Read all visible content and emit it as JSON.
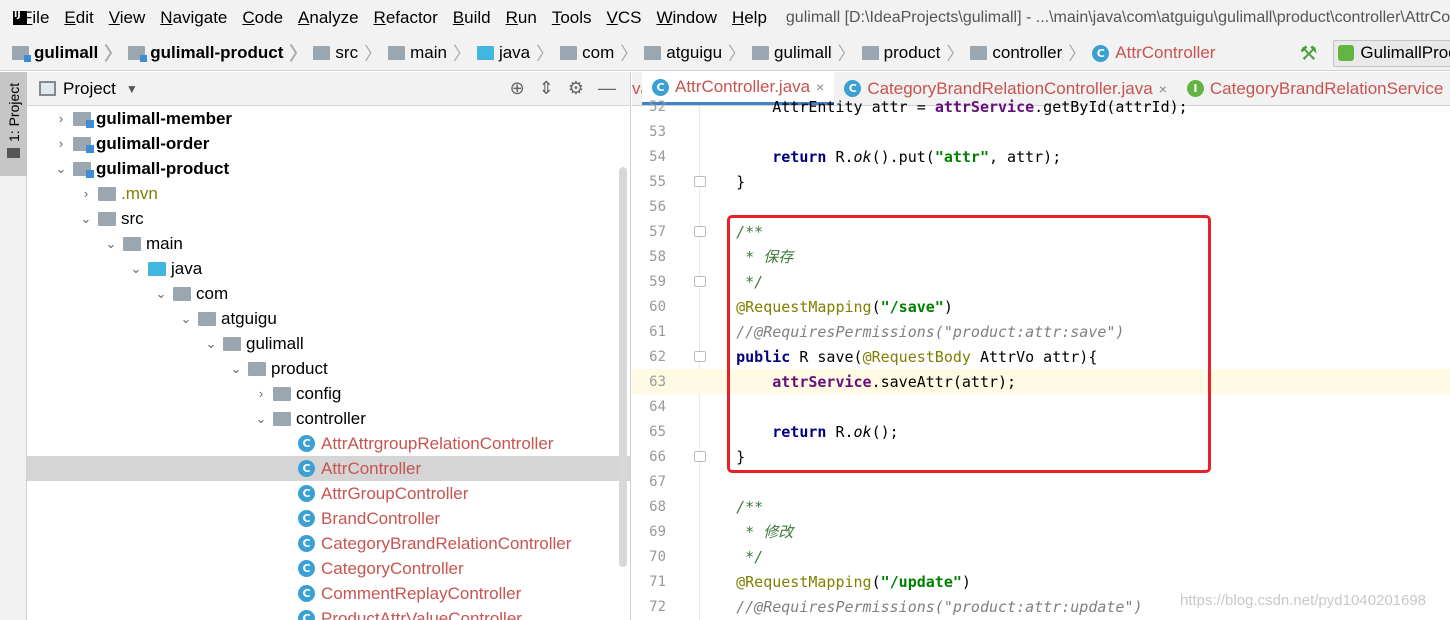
{
  "menu": {
    "items": [
      "File",
      "Edit",
      "View",
      "Navigate",
      "Code",
      "Analyze",
      "Refactor",
      "Build",
      "Run",
      "Tools",
      "VCS",
      "Window",
      "Help"
    ],
    "window_title": "gulimall [D:\\IdeaProjects\\gulimall] - ...\\main\\java\\com\\atguigu\\gulimall\\product\\controller\\AttrController.java"
  },
  "breadcrumb": {
    "items": [
      "gulimall",
      "gulimall-product",
      "src",
      "main",
      "java",
      "com",
      "atguigu",
      "gulimall",
      "product",
      "controller",
      "AttrController"
    ],
    "run_config": "GulimallProductApplication"
  },
  "toolstrip": {
    "tab_label": "1: Project"
  },
  "project_panel": {
    "title": "Project",
    "tree": [
      {
        "label": "gulimall-member",
        "depth": 0,
        "arrow": "›",
        "kind": "module"
      },
      {
        "label": "gulimall-order",
        "depth": 0,
        "arrow": "›",
        "kind": "module"
      },
      {
        "label": "gulimall-product",
        "depth": 0,
        "arrow": "⌄",
        "kind": "module"
      },
      {
        "label": ".mvn",
        "depth": 1,
        "arrow": "›",
        "kind": "folder-mvn"
      },
      {
        "label": "src",
        "depth": 1,
        "arrow": "⌄",
        "kind": "folder"
      },
      {
        "label": "main",
        "depth": 2,
        "arrow": "⌄",
        "kind": "folder"
      },
      {
        "label": "java",
        "depth": 3,
        "arrow": "⌄",
        "kind": "folder-blue"
      },
      {
        "label": "com",
        "depth": 4,
        "arrow": "⌄",
        "kind": "folder"
      },
      {
        "label": "atguigu",
        "depth": 5,
        "arrow": "⌄",
        "kind": "folder"
      },
      {
        "label": "gulimall",
        "depth": 6,
        "arrow": "⌄",
        "kind": "folder"
      },
      {
        "label": "product",
        "depth": 7,
        "arrow": "⌄",
        "kind": "folder"
      },
      {
        "label": "config",
        "depth": 8,
        "arrow": "›",
        "kind": "folder"
      },
      {
        "label": "controller",
        "depth": 8,
        "arrow": "⌄",
        "kind": "folder"
      },
      {
        "label": "AttrAttrgroupRelationController",
        "depth": 9,
        "arrow": "",
        "kind": "class"
      },
      {
        "label": "AttrController",
        "depth": 9,
        "arrow": "",
        "kind": "class",
        "selected": true
      },
      {
        "label": "AttrGroupController",
        "depth": 9,
        "arrow": "",
        "kind": "class"
      },
      {
        "label": "BrandController",
        "depth": 9,
        "arrow": "",
        "kind": "class"
      },
      {
        "label": "CategoryBrandRelationController",
        "depth": 9,
        "arrow": "",
        "kind": "class"
      },
      {
        "label": "CategoryController",
        "depth": 9,
        "arrow": "",
        "kind": "class"
      },
      {
        "label": "CommentReplayController",
        "depth": 9,
        "arrow": "",
        "kind": "class"
      },
      {
        "label": "ProductAttrValueController",
        "depth": 9,
        "arrow": "",
        "kind": "class"
      }
    ]
  },
  "editor": {
    "tabs": [
      {
        "label": "va",
        "icon": "",
        "close": false,
        "truncated": true
      },
      {
        "label": "AttrController.java",
        "icon": "C",
        "close": true,
        "active": true
      },
      {
        "label": "CategoryBrandRelationController.java",
        "icon": "C",
        "close": true
      },
      {
        "label": "CategoryBrandRelationService",
        "icon": "I",
        "close": false
      }
    ],
    "lines": [
      {
        "n": "52",
        "html": "        <span>AttrEntity attr = </span><span class=\"fld\">attrService</span><span>.getById(attrId);</span>"
      },
      {
        "n": "53",
        "html": ""
      },
      {
        "n": "54",
        "html": "        <span class=\"kw\">return</span> R.<span class=\"it\">ok</span>().put(<span class=\"str\">\"attr\"</span>, attr);"
      },
      {
        "n": "55",
        "html": "    }"
      },
      {
        "n": "56",
        "html": ""
      },
      {
        "n": "57",
        "html": "    <span class=\"doc\">/**</span>"
      },
      {
        "n": "58",
        "html": "    <span class=\"doc\"> * 保存</span>"
      },
      {
        "n": "59",
        "html": "    <span class=\"doc\"> */</span>"
      },
      {
        "n": "60",
        "html": "    <span class=\"an\">@RequestMapping</span>(<span class=\"str\">\"/save\"</span>)"
      },
      {
        "n": "61",
        "html": "    <span class=\"cm\">//@RequiresPermissions(\"product:attr:save\")</span>"
      },
      {
        "n": "62",
        "html": "    <span class=\"kw\">public</span> R save(<span class=\"an\">@RequestBody</span> AttrVo attr){"
      },
      {
        "n": "63",
        "html": "        <span class=\"fld\">attrService</span>.saveAttr(attr);",
        "current": true
      },
      {
        "n": "64",
        "html": ""
      },
      {
        "n": "65",
        "html": "        <span class=\"kw\">return</span> R.<span class=\"it\">ok</span>();"
      },
      {
        "n": "66",
        "html": "    }"
      },
      {
        "n": "67",
        "html": ""
      },
      {
        "n": "68",
        "html": "    <span class=\"doc\">/**</span>"
      },
      {
        "n": "69",
        "html": "    <span class=\"doc\"> * 修改</span>"
      },
      {
        "n": "70",
        "html": "    <span class=\"doc\"> */</span>"
      },
      {
        "n": "71",
        "html": "    <span class=\"an\">@RequestMapping</span>(<span class=\"str\">\"/update\"</span>)"
      },
      {
        "n": "72",
        "html": "    <span class=\"cm\">//@RequiresPermissions(\"product:attr:update\")</span>"
      }
    ],
    "fold_lines": [
      "55",
      "57",
      "59",
      "62",
      "66"
    ]
  },
  "watermark": "https://blog.csdn.net/pyd1040201698",
  "colors": {
    "highlight_box": "#e8202a",
    "active_tab_underline": "#4083c9",
    "current_line": "#fffae3"
  }
}
